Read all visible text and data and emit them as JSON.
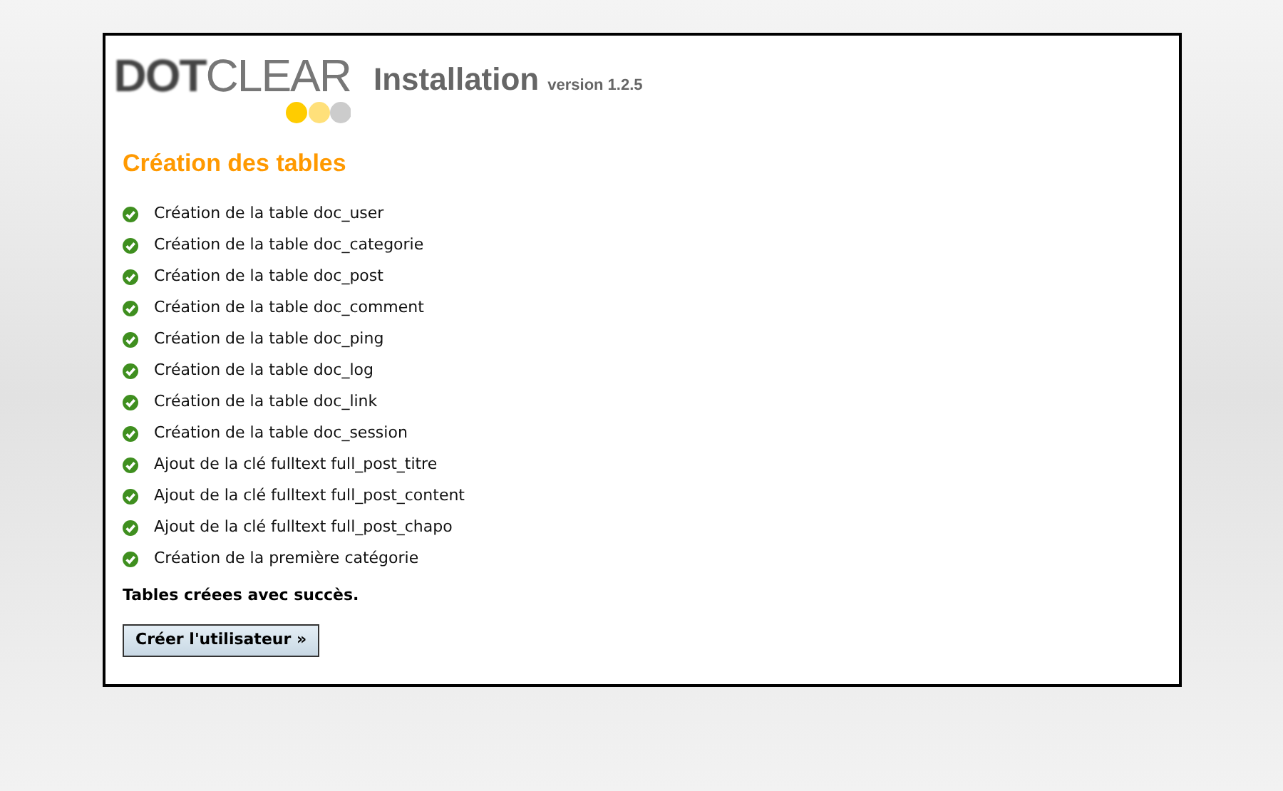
{
  "logo": {
    "bold_part": "DOT",
    "light_part": "CLEAR"
  },
  "header": {
    "title": "Installation",
    "version": "version 1.2.5"
  },
  "section_title": "Création des tables",
  "steps": [
    {
      "text": "Création de la table doc_user",
      "kind": "ok"
    },
    {
      "text": "Création de la table doc_categorie",
      "kind": "ok"
    },
    {
      "text": "Création de la table doc_post",
      "kind": "ok"
    },
    {
      "text": "Création de la table doc_comment",
      "kind": "ok"
    },
    {
      "text": "Création de la table doc_ping",
      "kind": "ok"
    },
    {
      "text": "Création de la table doc_log",
      "kind": "ok"
    },
    {
      "text": "Création de la table doc_link",
      "kind": "ok"
    },
    {
      "text": "Création de la table doc_session",
      "kind": "ok"
    },
    {
      "text": "Ajout de la clé fulltext full_post_titre",
      "kind": "ok"
    },
    {
      "text": "Ajout de la clé fulltext full_post_content",
      "kind": "ok"
    },
    {
      "text": "Ajout de la clé fulltext full_post_chapo",
      "kind": "ok"
    },
    {
      "text": "Création de la première catégorie",
      "kind": "ok"
    }
  ],
  "result_message": "Tables créees avec succès.",
  "next_button": "Créer l'utilisateur »"
}
